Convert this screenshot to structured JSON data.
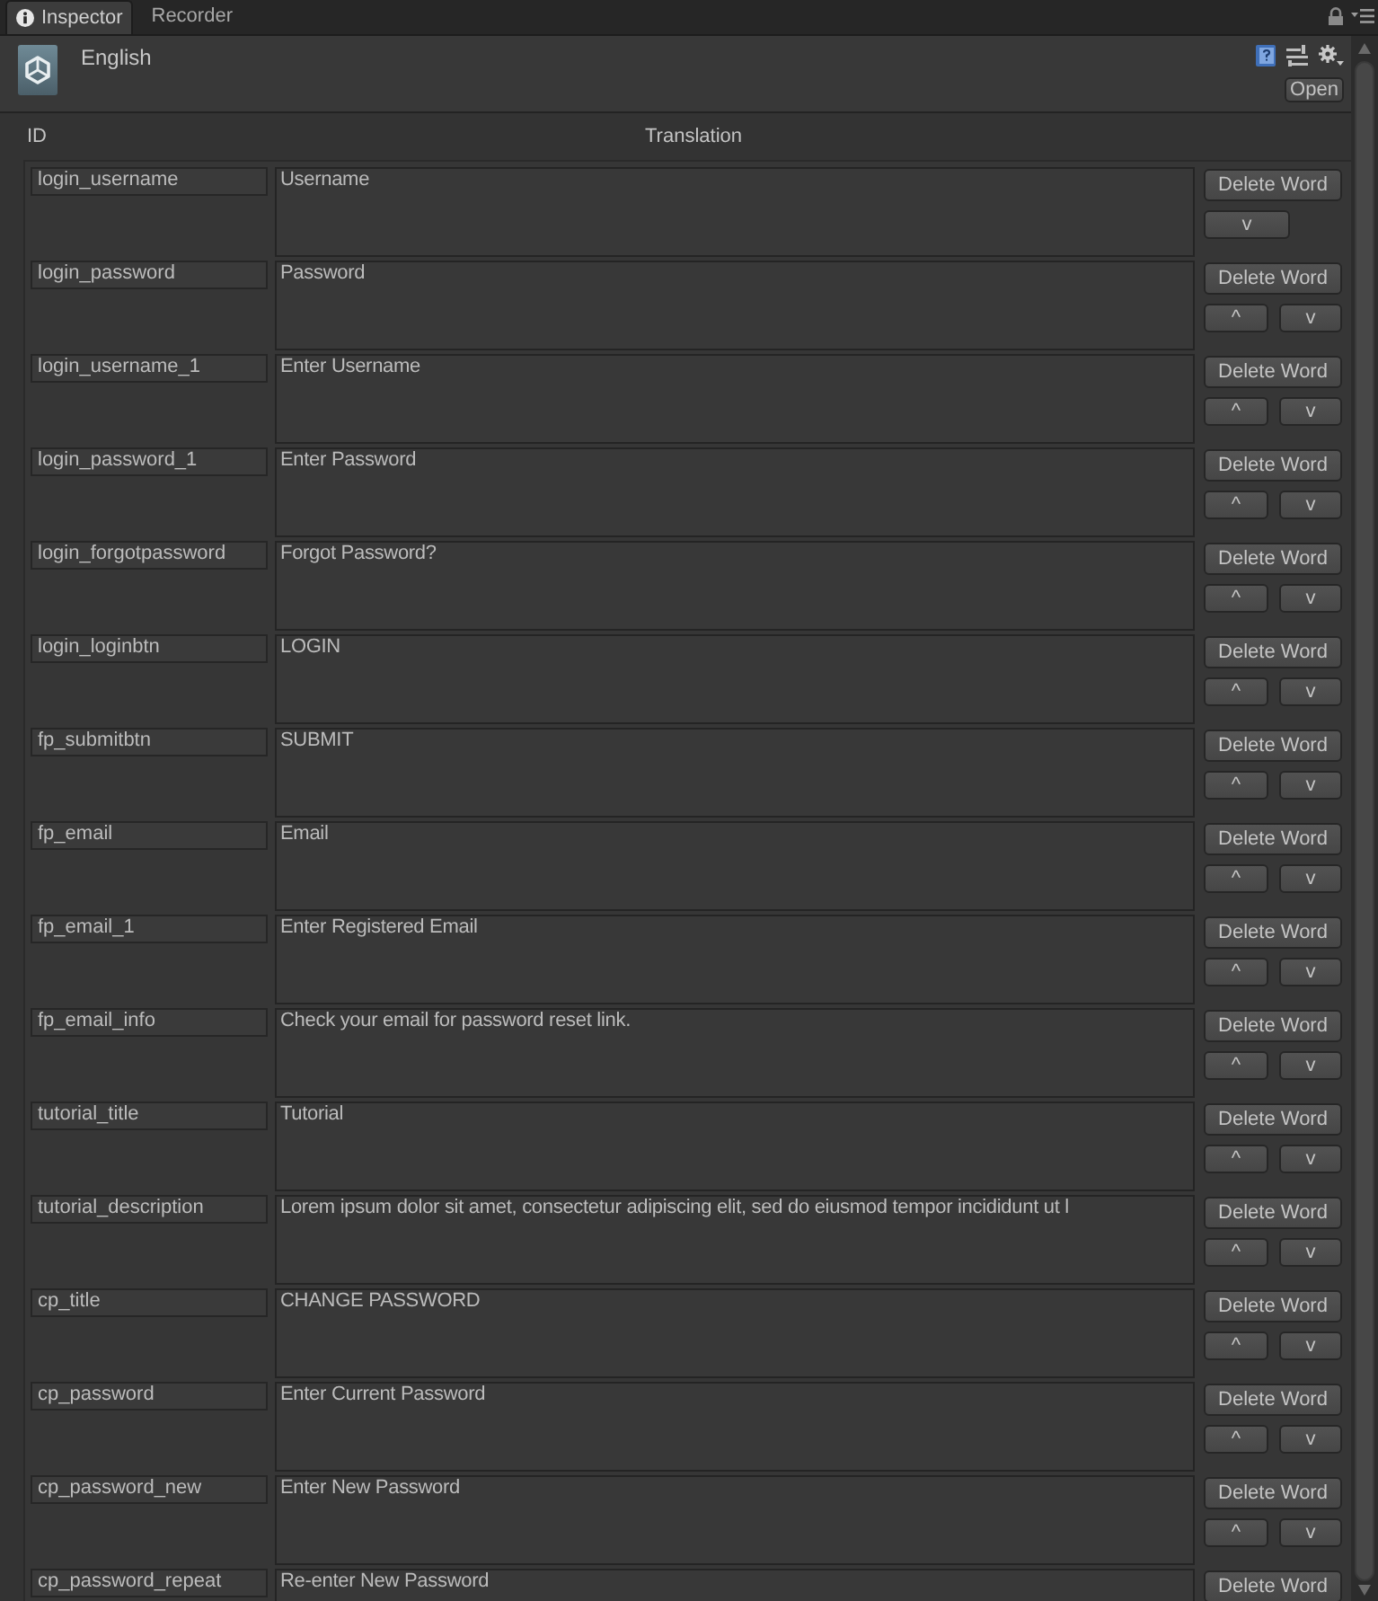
{
  "tabs": [
    {
      "label": "Inspector",
      "selected": true
    },
    {
      "label": "Recorder",
      "selected": false
    }
  ],
  "header": {
    "title": "English",
    "open_button": "Open"
  },
  "columns": {
    "id": "ID",
    "translation": "Translation"
  },
  "rows": [
    {
      "id": "login_username",
      "translation": "Username",
      "delete_button": "Delete Word",
      "down_button": "v"
    },
    {
      "id": "login_password",
      "translation": "Password",
      "delete_button": "Delete Word",
      "up_button": "^",
      "down_button": "v"
    },
    {
      "id": "login_username_1",
      "translation": "Enter Username",
      "delete_button": "Delete Word",
      "up_button": "^",
      "down_button": "v"
    },
    {
      "id": "login_password_1",
      "translation": "Enter Password",
      "delete_button": "Delete Word",
      "up_button": "^",
      "down_button": "v"
    },
    {
      "id": "login_forgotpassword",
      "translation": "Forgot Password?",
      "delete_button": "Delete Word",
      "up_button": "^",
      "down_button": "v"
    },
    {
      "id": "login_loginbtn",
      "translation": "LOGIN",
      "delete_button": "Delete Word",
      "up_button": "^",
      "down_button": "v"
    },
    {
      "id": "fp_submitbtn",
      "translation": "SUBMIT",
      "delete_button": "Delete Word",
      "up_button": "^",
      "down_button": "v"
    },
    {
      "id": "fp_email",
      "translation": "Email",
      "delete_button": "Delete Word",
      "up_button": "^",
      "down_button": "v"
    },
    {
      "id": "fp_email_1",
      "translation": "Enter Registered Email",
      "delete_button": "Delete Word",
      "up_button": "^",
      "down_button": "v"
    },
    {
      "id": "fp_email_info",
      "translation": "Check your email for password reset link.",
      "delete_button": "Delete Word",
      "up_button": "^",
      "down_button": "v"
    },
    {
      "id": "tutorial_title",
      "translation": "Tutorial",
      "delete_button": "Delete Word",
      "up_button": "^",
      "down_button": "v"
    },
    {
      "id": "tutorial_description",
      "translation": "Lorem ipsum dolor sit amet, consectetur adipiscing elit, sed do eiusmod tempor incididunt ut l",
      "delete_button": "Delete Word",
      "up_button": "^",
      "down_button": "v"
    },
    {
      "id": "cp_title",
      "translation": "CHANGE PASSWORD",
      "delete_button": "Delete Word",
      "up_button": "^",
      "down_button": "v"
    },
    {
      "id": "cp_password",
      "translation": "Enter Current Password",
      "delete_button": "Delete Word",
      "up_button": "^",
      "down_button": "v"
    },
    {
      "id": "cp_password_new",
      "translation": "Enter New Password",
      "delete_button": "Delete Word",
      "up_button": "^",
      "down_button": "v"
    },
    {
      "id": "cp_password_repeat",
      "translation": "Re-enter New Password",
      "delete_button": "Delete Word"
    }
  ]
}
